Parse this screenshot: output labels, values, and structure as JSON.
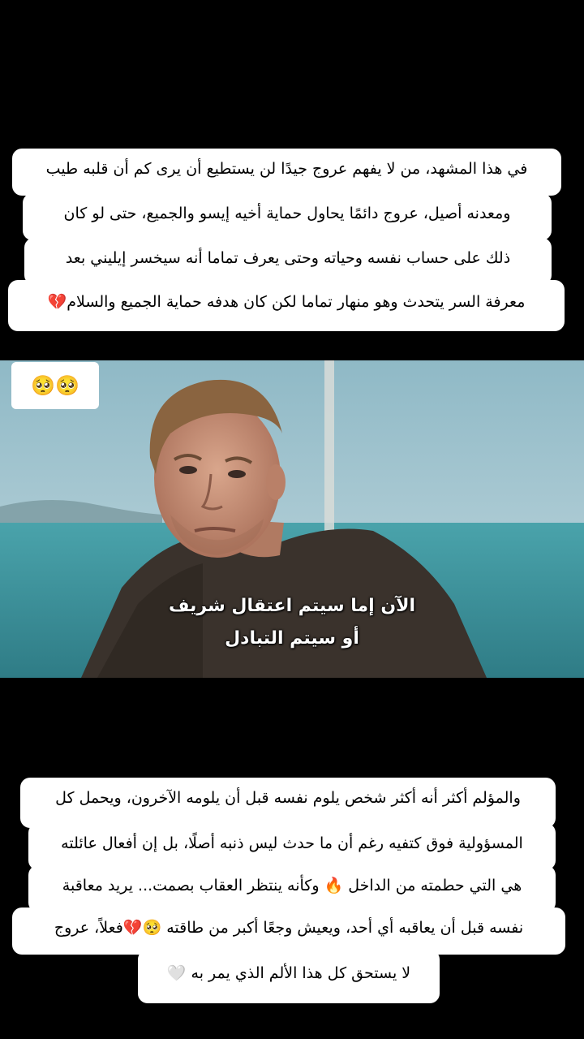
{
  "top_caption": {
    "lines": [
      "في هذا المشهد، من لا يفهم عروج جيدًا لن يستطيع أن يرى كم أن قلبه طيب",
      "ومعدنه أصيل، عروج دائمًا يحاول حماية أخيه إيسو والجميع، حتى لو كان",
      "ذلك على حساب نفسه وحياته وحتى يعرف تماما أنه سيخسر إيليني بعد",
      "معرفة السر يتحدث وهو منهار تماما لكن كان هدفه حماية الجميع والسلام💔"
    ]
  },
  "video": {
    "sticker_emoji": "🥺🥺",
    "subtitle_line1": "الآن إما سيتم اعتقال شريف",
    "subtitle_line2": "أو سيتم التبادل"
  },
  "bottom_caption": {
    "lines": [
      "والمؤلم أكثر أنه أكثر شخص يلوم نفسه قبل أن يلومه الآخرون، ويحمل كل",
      "المسؤولية فوق كتفيه رغم أن ما حدث ليس ذنبه أصلًا، بل إن أفعال عائلته",
      "هي التي حطمته من الداخل 🔥 وكأنه ينتظر العقاب بصمت... يريد معاقبة",
      "نفسه قبل أن يعاقبه أي أحد، ويعيش وجعًا أكبر من طاقته 🥺💔فعلاً، عروج",
      "لا يستحق كل هذا الألم الذي يمر به 🤍"
    ]
  },
  "colors": {
    "background": "#000000",
    "caption_bg": "#ffffff",
    "caption_text": "#000000",
    "sea": "#3e8f9a",
    "sky": "#9fc1cc"
  }
}
